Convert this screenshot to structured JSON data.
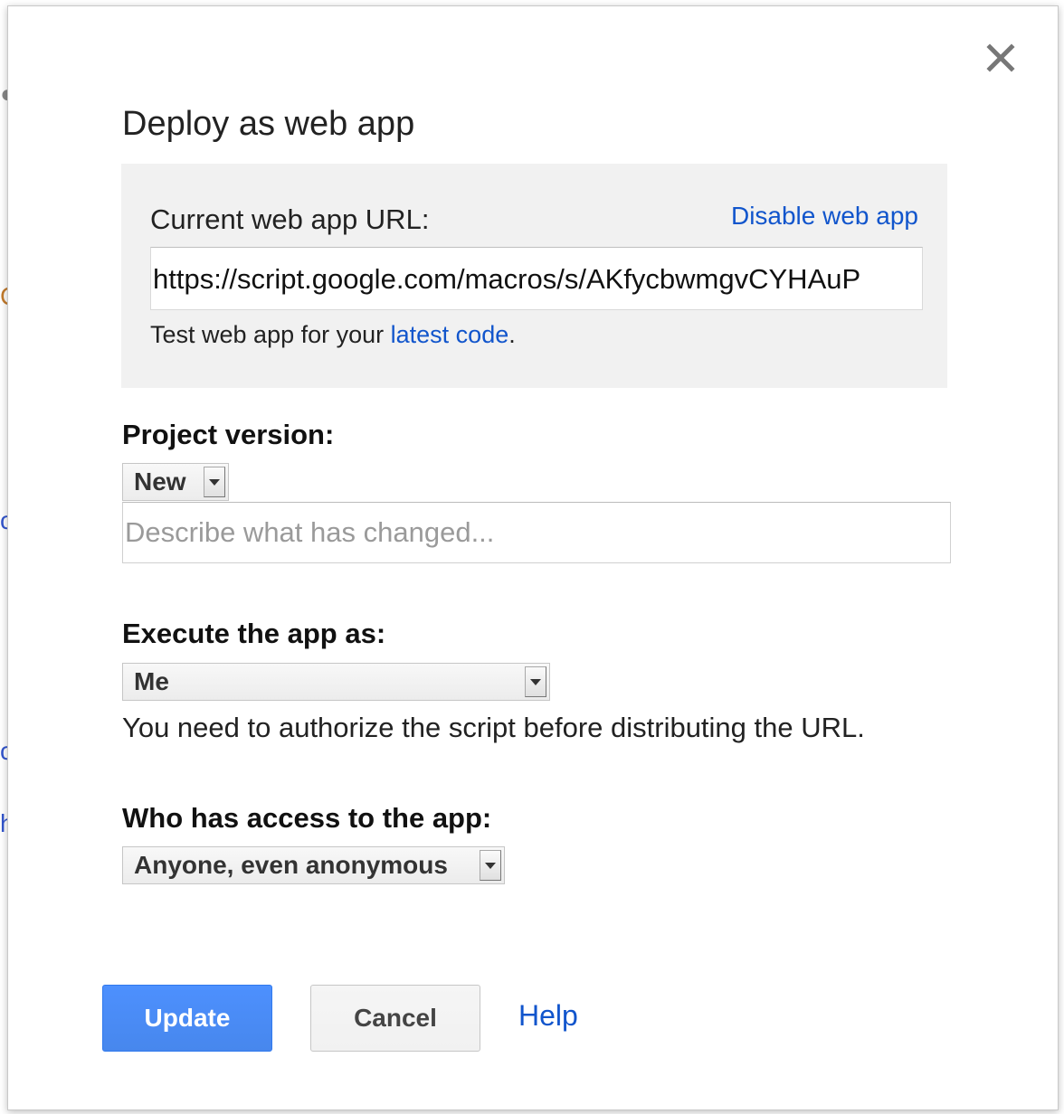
{
  "dialog": {
    "title": "Deploy as web app",
    "close_icon": "close-icon"
  },
  "url_panel": {
    "label": "Current web app URL:",
    "disable_link": "Disable web app",
    "url_value": "https://script.google.com/macros/s/AKfycbwmgvCYHAuP",
    "test_prefix": "Test web app for your ",
    "test_link": "latest code",
    "test_suffix": "."
  },
  "project_version": {
    "label": "Project version:",
    "selected": "New",
    "description_placeholder": "Describe what has changed..."
  },
  "execute_as": {
    "label": "Execute the app as:",
    "selected": "Me",
    "note": "You need to authorize the script before distributing the URL."
  },
  "access": {
    "label": "Who has access to the app:",
    "selected": "Anyone, even anonymous"
  },
  "footer": {
    "update_label": "Update",
    "cancel_label": "Cancel",
    "help_label": "Help"
  },
  "colors": {
    "link": "#1155cc",
    "primary_button": "#4d90fe",
    "panel_background": "#f1f1f1"
  }
}
